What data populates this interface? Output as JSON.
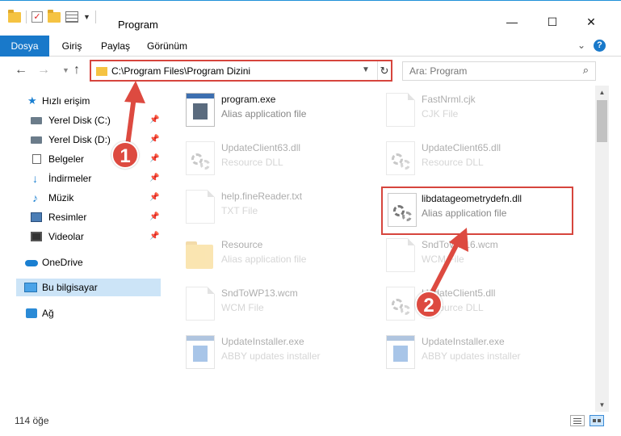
{
  "window": {
    "title": "Program",
    "minimize_glyph": "—",
    "maximize_glyph": "☐",
    "close_glyph": "✕"
  },
  "ribbon": {
    "tabs": [
      "Dosya",
      "Giriş",
      "Paylaş",
      "Görünüm"
    ],
    "active_tab": "Dosya",
    "accent": "#1979CA",
    "help_label": "?"
  },
  "navigation": {
    "address_path": "C:\\Program Files\\Program Dizini",
    "search_placeholder": "Ara: Program"
  },
  "sidebar": {
    "items": [
      {
        "label": "Hızlı erişim",
        "icon": "star-icon",
        "pinned": false
      },
      {
        "label": "Yerel Disk (C:)",
        "icon": "disk-icon",
        "pinned": true
      },
      {
        "label": "Yerel Disk (D:)",
        "icon": "disk-icon",
        "pinned": true
      },
      {
        "label": "Belgeler",
        "icon": "document-icon",
        "pinned": true
      },
      {
        "label": "İndirmeler",
        "icon": "download-icon",
        "pinned": true
      },
      {
        "label": "Müzik",
        "icon": "music-icon",
        "pinned": true
      },
      {
        "label": "Resimler",
        "icon": "pictures-icon",
        "pinned": true
      },
      {
        "label": "Videolar",
        "icon": "video-icon",
        "pinned": true
      },
      {
        "label": "OneDrive",
        "icon": "cloud-icon",
        "pinned": false
      },
      {
        "label": "Bu bilgisayar",
        "icon": "computer-icon",
        "pinned": false,
        "selected": true
      },
      {
        "label": "Ağ",
        "icon": "network-icon",
        "pinned": false
      }
    ]
  },
  "files": [
    {
      "name": "program.exe",
      "type": "Alias application file",
      "icon": "exe-icon"
    },
    {
      "name": "FastNrml.cjk",
      "type": "CJK File",
      "icon": "document-icon"
    },
    {
      "name": "UpdateClient63.dll",
      "type": "Resource DLL",
      "icon": "gear-file-icon"
    },
    {
      "name": "UpdateClient65.dll",
      "type": "Resource DLL",
      "icon": "gear-file-icon"
    },
    {
      "name": "help.fineReader.txt",
      "type": "TXT File",
      "icon": "document-icon"
    },
    {
      "name": "libdatageometrydefn.dll",
      "type": "Alias application file",
      "icon": "gear-file-icon",
      "highlighted": true
    },
    {
      "name": "Resource",
      "type": "Alias application file",
      "icon": "folder-icon"
    },
    {
      "name": "SndToWP16.wcm",
      "type": "WCM File",
      "icon": "document-icon"
    },
    {
      "name": "SndToWP13.wcm",
      "type": "WCM File",
      "icon": "document-icon"
    },
    {
      "name": "UpdateClient5.dll",
      "type": "Resource DLL",
      "icon": "gear-file-icon"
    },
    {
      "name": "UpdateInstaller.exe",
      "type": "ABBY updates installer",
      "icon": "installer-icon"
    },
    {
      "name": "UpdateInstaller.exe",
      "type": "ABBY updates installer",
      "icon": "installer-icon"
    }
  ],
  "callouts": [
    "1",
    "2"
  ],
  "status": {
    "item_count": "114 öğe"
  },
  "colors": {
    "highlight_border": "#D6453D",
    "callout_fill": "#DD4A40",
    "selection": "#CCE4F7"
  }
}
